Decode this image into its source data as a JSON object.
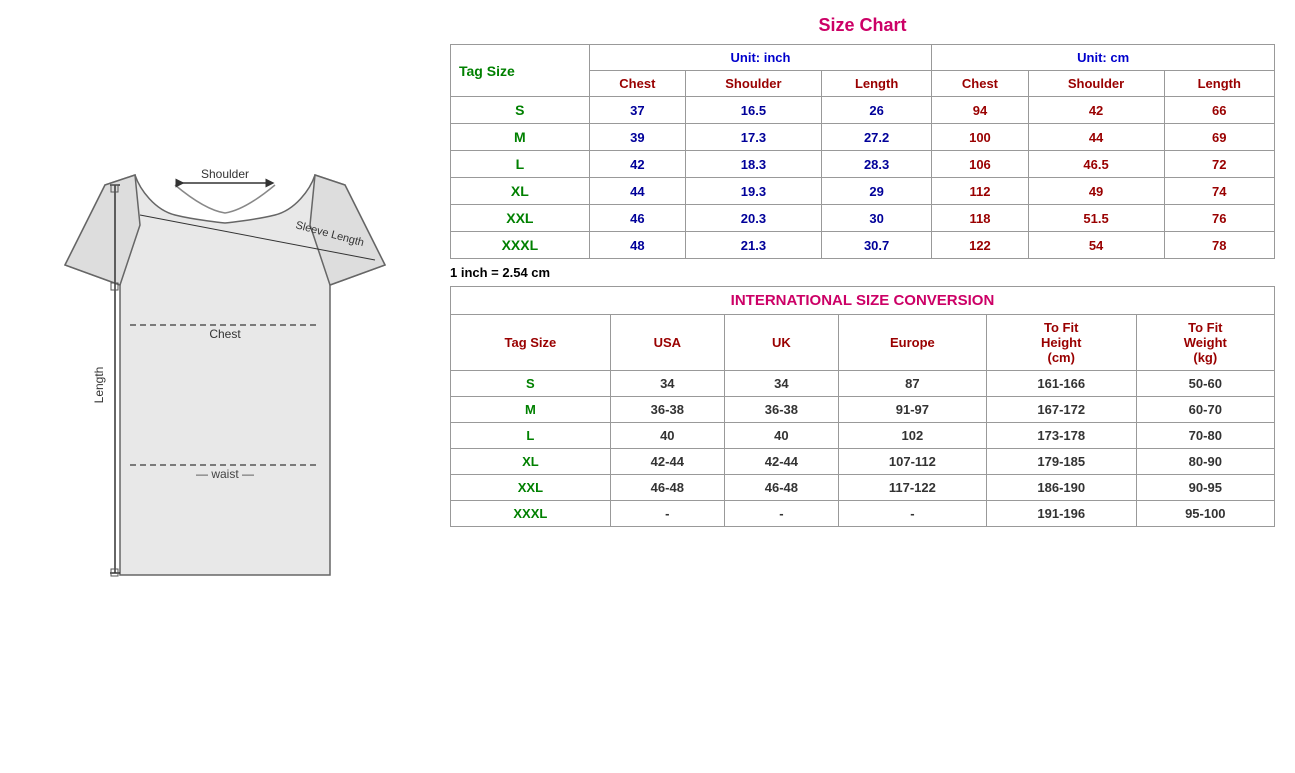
{
  "title": "Size Chart",
  "inch_note": "1 inch = 2.54 cm",
  "unit_inch": "Unit: inch",
  "unit_cm": "Unit: cm",
  "tag_size_label": "Tag Size",
  "headers_inch": [
    "Chest",
    "Shoulder",
    "Length"
  ],
  "headers_cm": [
    "Chest",
    "Shoulder",
    "Length"
  ],
  "size_rows": [
    {
      "tag": "S",
      "inch_chest": "37",
      "inch_shoulder": "16.5",
      "inch_length": "26",
      "cm_chest": "94",
      "cm_shoulder": "42",
      "cm_length": "66"
    },
    {
      "tag": "M",
      "inch_chest": "39",
      "inch_shoulder": "17.3",
      "inch_length": "27.2",
      "cm_chest": "100",
      "cm_shoulder": "44",
      "cm_length": "69"
    },
    {
      "tag": "L",
      "inch_chest": "42",
      "inch_shoulder": "18.3",
      "inch_length": "28.3",
      "cm_chest": "106",
      "cm_shoulder": "46.5",
      "cm_length": "72"
    },
    {
      "tag": "XL",
      "inch_chest": "44",
      "inch_shoulder": "19.3",
      "inch_length": "29",
      "cm_chest": "112",
      "cm_shoulder": "49",
      "cm_length": "74"
    },
    {
      "tag": "XXL",
      "inch_chest": "46",
      "inch_shoulder": "20.3",
      "inch_length": "30",
      "cm_chest": "118",
      "cm_shoulder": "51.5",
      "cm_length": "76"
    },
    {
      "tag": "XXXL",
      "inch_chest": "48",
      "inch_shoulder": "21.3",
      "inch_length": "30.7",
      "cm_chest": "122",
      "cm_shoulder": "54",
      "cm_length": "78"
    }
  ],
  "conversion_title": "INTERNATIONAL SIZE CONVERSION",
  "intl_headers": [
    "Tag Size",
    "USA",
    "UK",
    "Europe",
    "To Fit Height (cm)",
    "To Fit Weight (kg)"
  ],
  "intl_rows": [
    {
      "tag": "S",
      "usa": "34",
      "uk": "34",
      "europe": "87",
      "height": "161-166",
      "weight": "50-60"
    },
    {
      "tag": "M",
      "usa": "36-38",
      "uk": "36-38",
      "europe": "91-97",
      "height": "167-172",
      "weight": "60-70"
    },
    {
      "tag": "L",
      "usa": "40",
      "uk": "40",
      "europe": "102",
      "height": "173-178",
      "weight": "70-80"
    },
    {
      "tag": "XL",
      "usa": "42-44",
      "uk": "42-44",
      "europe": "107-112",
      "height": "179-185",
      "weight": "80-90"
    },
    {
      "tag": "XXL",
      "usa": "46-48",
      "uk": "46-48",
      "europe": "117-122",
      "height": "186-190",
      "weight": "90-95"
    },
    {
      "tag": "XXXL",
      "usa": "-",
      "uk": "-",
      "europe": "-",
      "height": "191-196",
      "weight": "95-100"
    }
  ]
}
